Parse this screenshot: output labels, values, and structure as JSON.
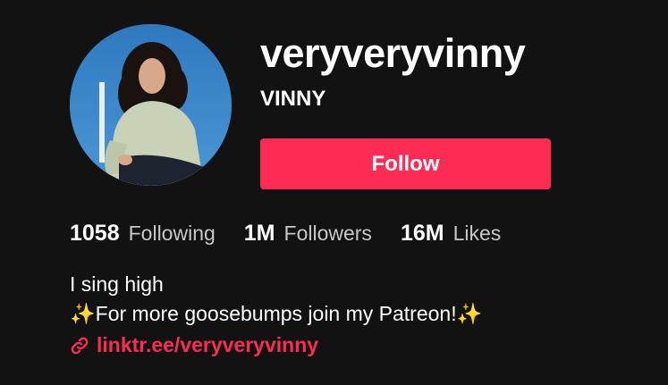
{
  "profile": {
    "username": "veryveryvinny",
    "nickname": "VINNY",
    "follow_label": "Follow",
    "avatar_icon": "user-avatar-photo"
  },
  "stats": [
    {
      "value": "1058",
      "label": "Following"
    },
    {
      "value": "1M",
      "label": "Followers"
    },
    {
      "value": "16M",
      "label": "Likes"
    }
  ],
  "bio": {
    "line1": "I sing high",
    "line2_sparkle_left": "✨",
    "line2_text": "For more goosebumps join my Patreon!",
    "line2_sparkle_right": "✨"
  },
  "link": {
    "icon": "link-icon",
    "text": "linktr.ee/veryveryvinny"
  },
  "colors": {
    "background": "#121212",
    "accent": "#fe2c55",
    "muted_text": "#c8c8c8"
  }
}
